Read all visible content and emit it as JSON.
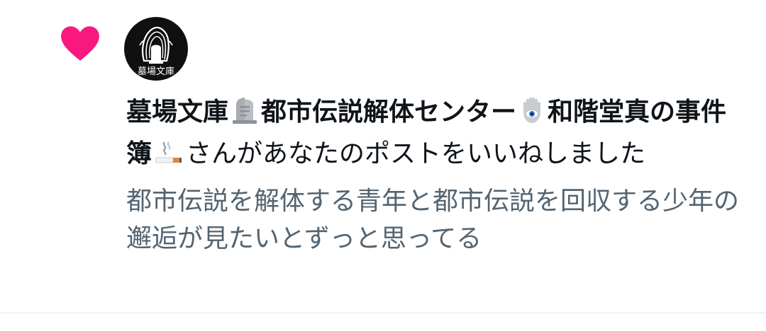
{
  "notification": {
    "type_icon": "heart-icon",
    "type_icon_color": "#f91880",
    "avatar": {
      "icon": "graveyard-library-logo",
      "background": "#101010",
      "logo_text": "墓場文庫"
    },
    "liker": {
      "name_part1": "墓場文庫",
      "emoji1": "headstone-emoji",
      "name_part2": "都市伝説解体センター",
      "emoji2": "hamsa-emoji",
      "name_part3": "和階堂真の事件簿",
      "emoji3": "cigarette-emoji"
    },
    "action_text": "さんがあなたのポストをいいねしました",
    "post_preview": "都市伝説を解体する青年と都市伝説を回収する少年の邂逅が見たいとずっと思ってる"
  },
  "colors": {
    "primary_text": "#0f1419",
    "secondary_text": "#536471",
    "like": "#f91880",
    "divider": "#e1e8ed"
  }
}
